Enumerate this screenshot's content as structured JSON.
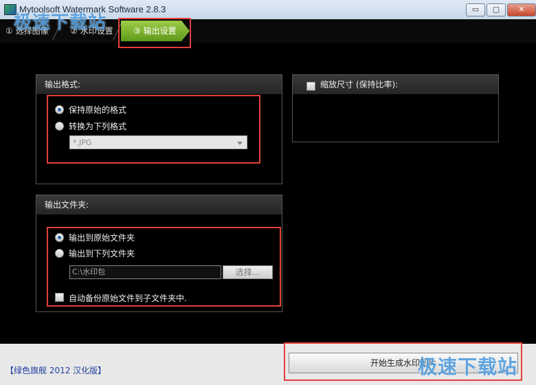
{
  "window": {
    "title": "Mytoolsoft Watermark Software 2.8.3",
    "controls": {
      "minimize": "▭",
      "maximize": "▢",
      "close": "✕"
    }
  },
  "watermark": {
    "logo_text": "极速下载站"
  },
  "steps": [
    {
      "label": "① 选择图像"
    },
    {
      "label": "② 水印设置"
    },
    {
      "label": "③ 输出设置"
    }
  ],
  "output_format": {
    "heading": "输出格式:",
    "keep_original": "保持原始的格式",
    "convert_to": "转换为下列格式",
    "format_selected": "*.JPG"
  },
  "resize": {
    "label": "缩放尺寸 (保持比率):"
  },
  "output_folder": {
    "heading": "输出文件夹:",
    "to_original": "输出到原始文件夹",
    "to_following": "输出到下列文件夹",
    "path_value": "C:\\水印包",
    "choose_button": "选择...",
    "backup_option": "自动备份原始文件到子文件夹中."
  },
  "footer": {
    "credit": "【绿色旗舰 2012 汉化版】",
    "start_button": "开始生成水印图片"
  },
  "colors": {
    "accent_green": "#7fb632",
    "highlight_red": "#e3403a",
    "footer_blue": "#1e3f9e"
  }
}
